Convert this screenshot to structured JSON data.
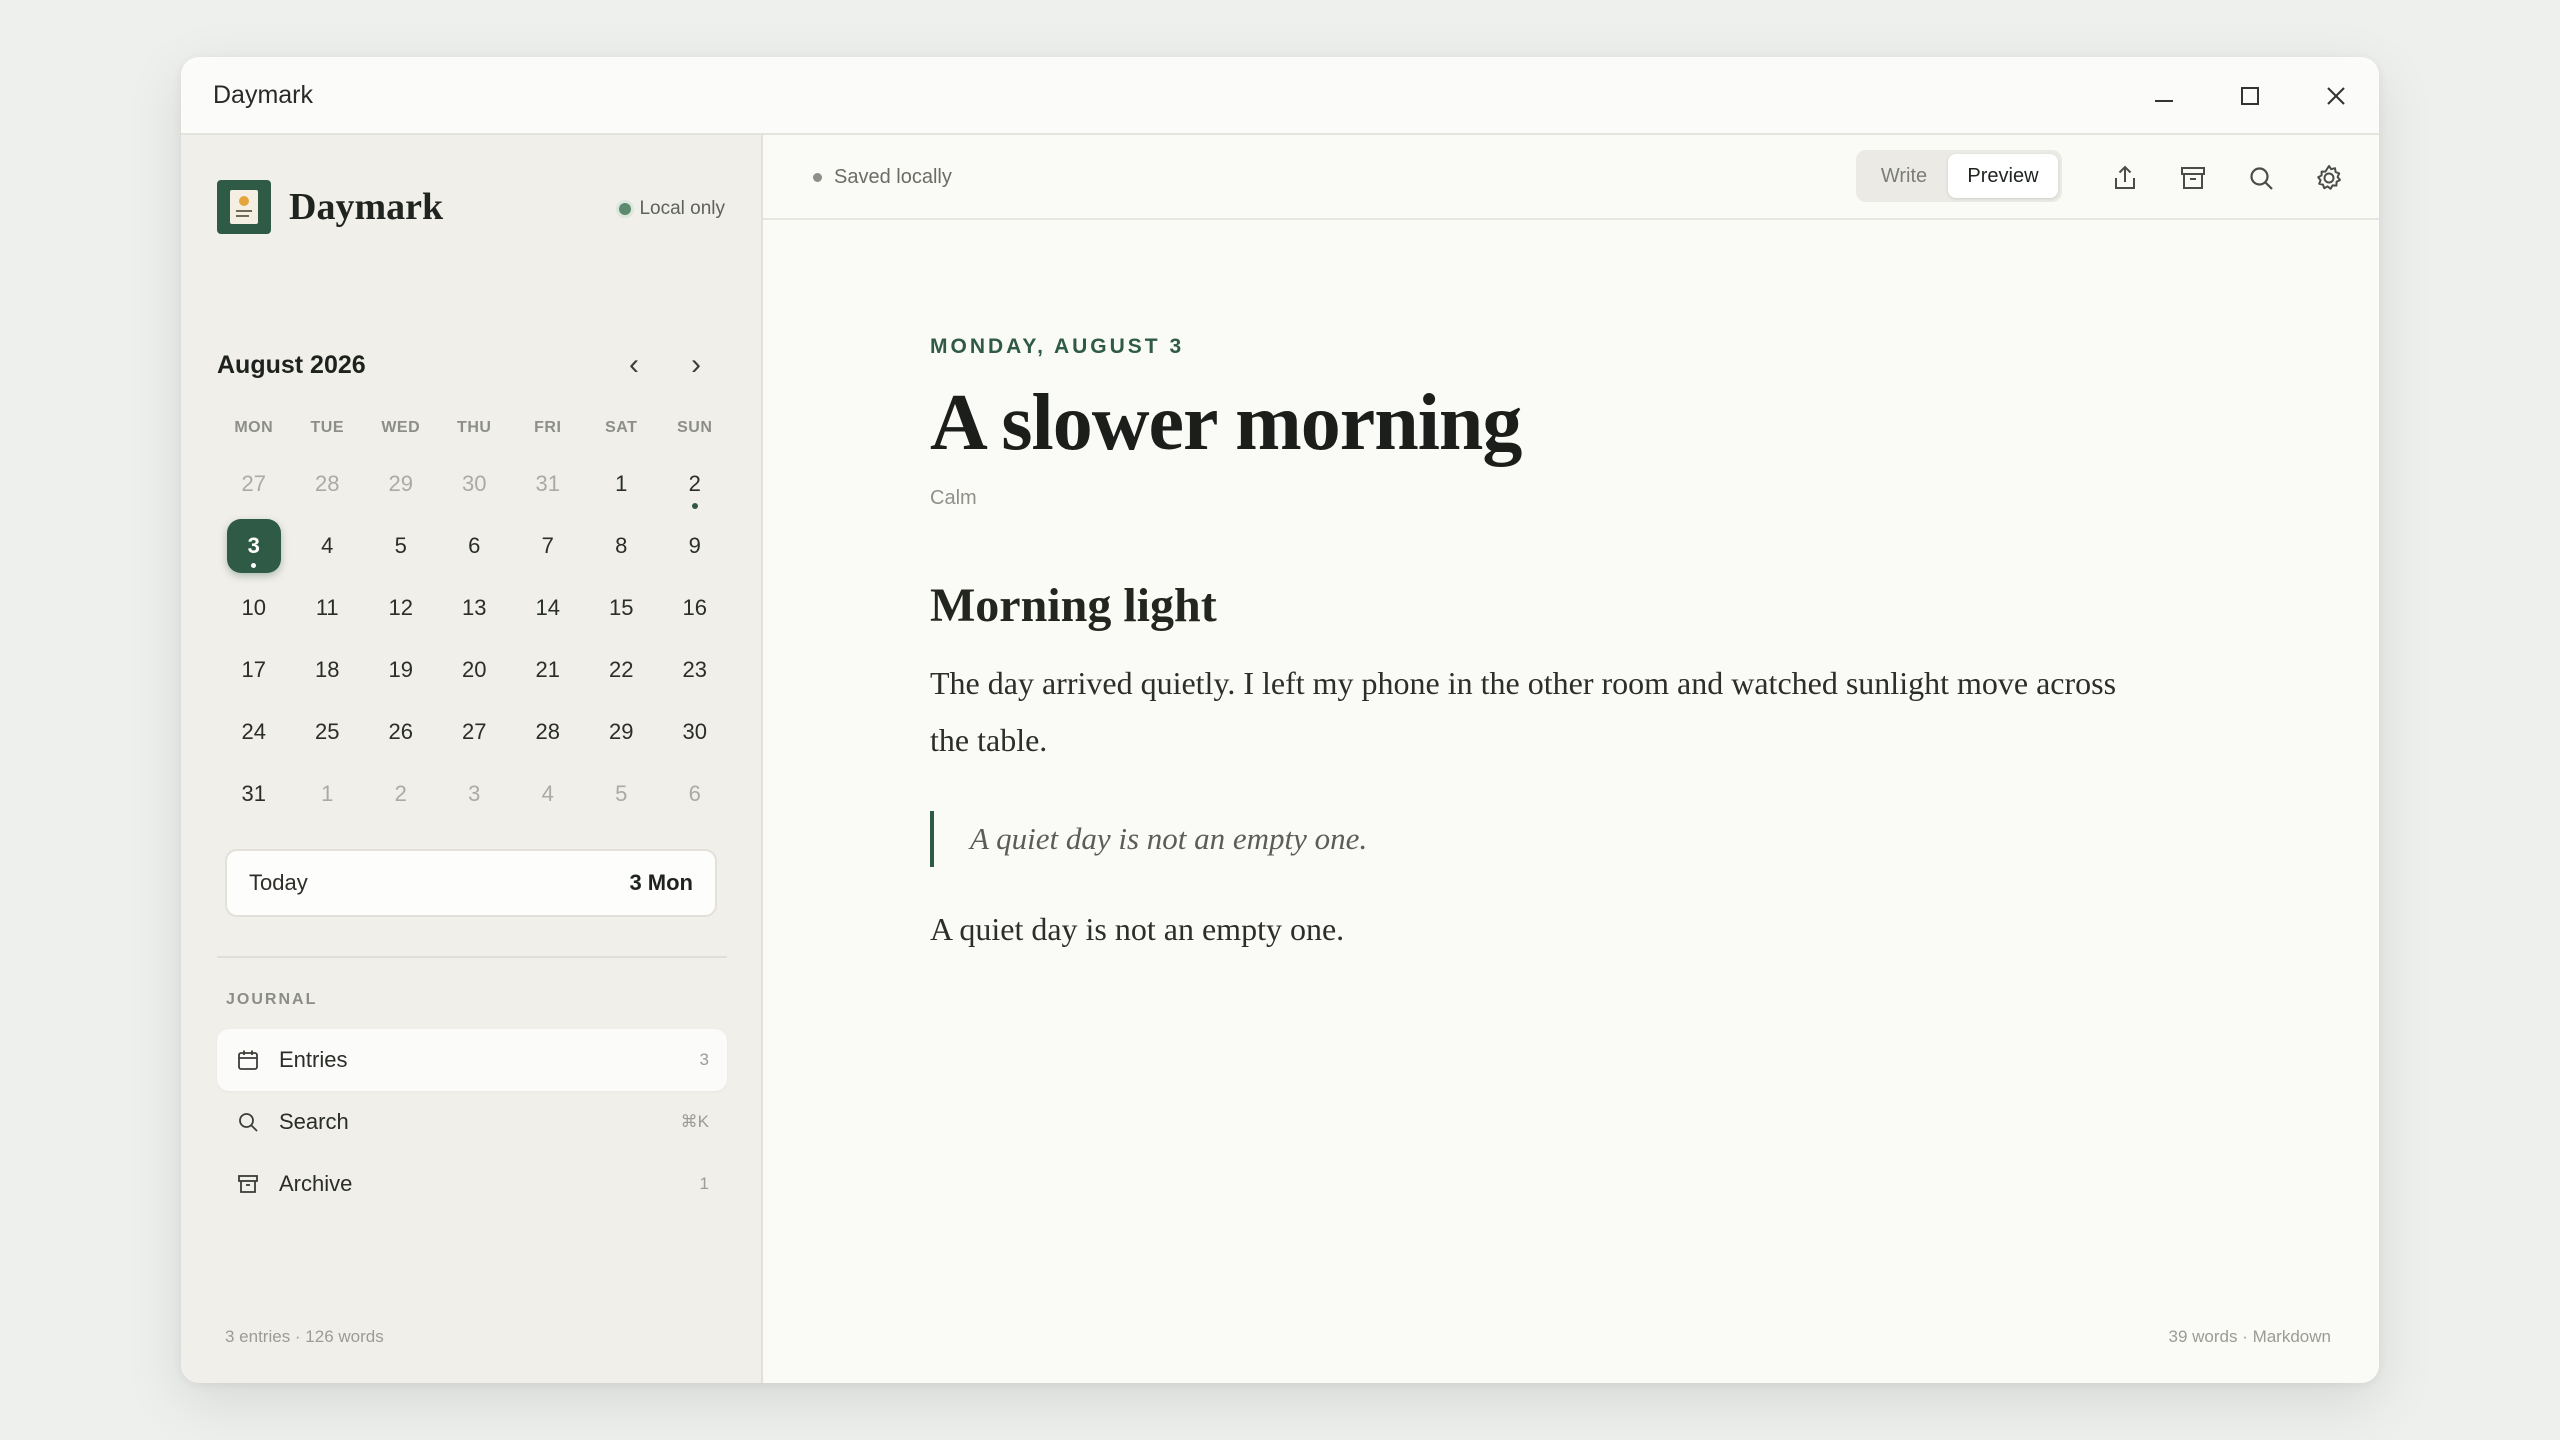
{
  "window": {
    "title": "Daymark"
  },
  "sidebar": {
    "brand": "Daymark",
    "local_badge": "Local only",
    "calendar": {
      "month_label": "August 2026",
      "prev": "‹",
      "next": "›",
      "weekdays": [
        "MON",
        "TUE",
        "WED",
        "THU",
        "FRI",
        "SAT",
        "SUN"
      ],
      "weeks": [
        [
          {
            "d": "27",
            "muted": true
          },
          {
            "d": "28",
            "muted": true
          },
          {
            "d": "29",
            "muted": true
          },
          {
            "d": "30",
            "muted": true
          },
          {
            "d": "31",
            "muted": true
          },
          {
            "d": "1"
          },
          {
            "d": "2",
            "mark": true
          }
        ],
        [
          {
            "d": "3",
            "today": true,
            "mark": true
          },
          {
            "d": "4"
          },
          {
            "d": "5"
          },
          {
            "d": "6"
          },
          {
            "d": "7"
          },
          {
            "d": "8"
          },
          {
            "d": "9"
          }
        ],
        [
          {
            "d": "10"
          },
          {
            "d": "11"
          },
          {
            "d": "12"
          },
          {
            "d": "13"
          },
          {
            "d": "14"
          },
          {
            "d": "15"
          },
          {
            "d": "16"
          }
        ],
        [
          {
            "d": "17"
          },
          {
            "d": "18"
          },
          {
            "d": "19"
          },
          {
            "d": "20"
          },
          {
            "d": "21"
          },
          {
            "d": "22"
          },
          {
            "d": "23"
          }
        ],
        [
          {
            "d": "24"
          },
          {
            "d": "25"
          },
          {
            "d": "26"
          },
          {
            "d": "27"
          },
          {
            "d": "28"
          },
          {
            "d": "29"
          },
          {
            "d": "30"
          }
        ],
        [
          {
            "d": "31"
          },
          {
            "d": "1",
            "muted": true
          },
          {
            "d": "2",
            "muted": true
          },
          {
            "d": "3",
            "muted": true
          },
          {
            "d": "4",
            "muted": true
          },
          {
            "d": "5",
            "muted": true
          },
          {
            "d": "6",
            "muted": true
          }
        ]
      ]
    },
    "today_card": {
      "label": "Today",
      "value": "3 Mon"
    },
    "section_label": "JOURNAL",
    "nav": [
      {
        "label": "Entries",
        "count": "3",
        "icon": "calendar-icon",
        "active": true
      },
      {
        "label": "Search",
        "count": "⌘K",
        "icon": "search-icon"
      },
      {
        "label": "Archive",
        "count": "1",
        "icon": "archive-icon"
      }
    ],
    "footer": "3 entries · 126 words"
  },
  "toolbar": {
    "status": "Saved locally",
    "mode_write": "Write",
    "mode_preview": "Preview",
    "active_mode": "Preview",
    "icons": [
      "share-icon",
      "archive-icon",
      "search-icon",
      "settings-icon"
    ]
  },
  "entry": {
    "date": "MONDAY, AUGUST 3",
    "title": "A slower morning",
    "mood": "Calm",
    "heading": "Morning light",
    "paragraph": "The day arrived quietly. I left my phone in the other room and watched sunlight move across the table.",
    "quote": "A quiet day is not an empty one.",
    "closing": "A quiet day is not an empty one."
  },
  "status_bar": "39 words · Markdown",
  "colors": {
    "accent": "#2f5a45",
    "sidebar_bg": "#f1efe9",
    "page_bg": "#fafaf7"
  }
}
